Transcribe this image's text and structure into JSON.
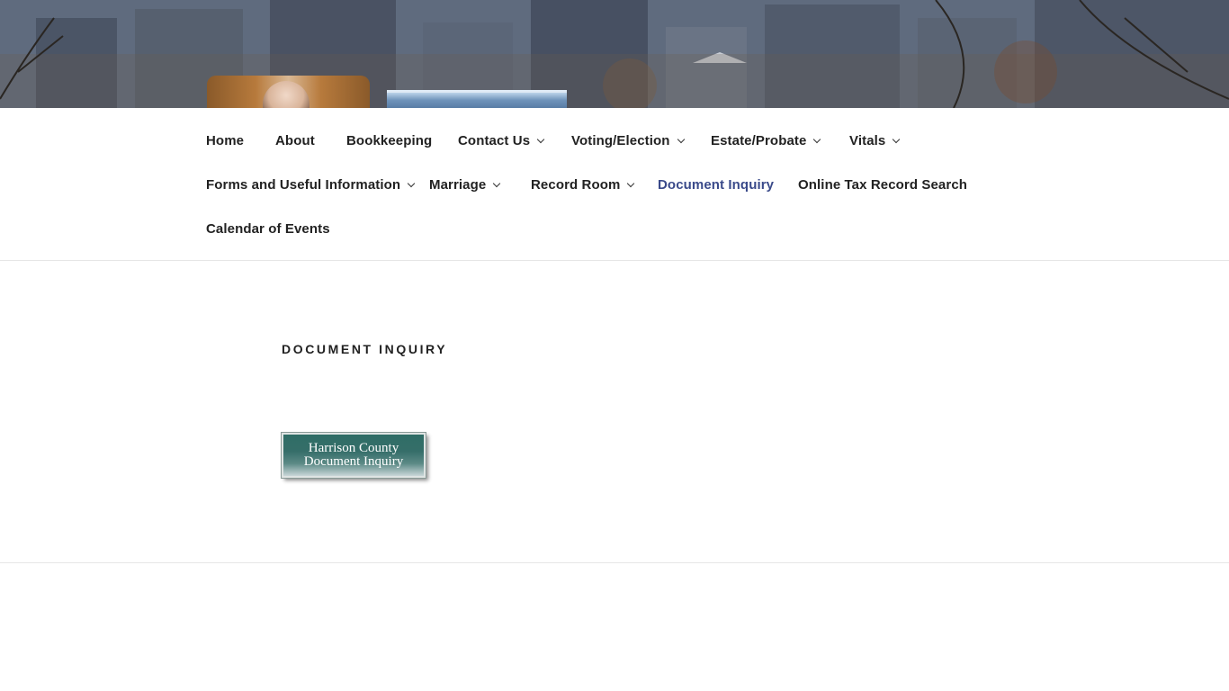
{
  "nav": {
    "row1": [
      {
        "label": "Home",
        "dropdown": false
      },
      {
        "label": "About",
        "dropdown": false
      },
      {
        "label": "Bookkeeping",
        "dropdown": false
      },
      {
        "label": "Contact Us",
        "dropdown": true
      },
      {
        "label": "Voting/Election",
        "dropdown": true
      },
      {
        "label": "Estate/Probate",
        "dropdown": true
      },
      {
        "label": "Vitals",
        "dropdown": true
      }
    ],
    "row2": [
      {
        "label": "Forms and Useful Information",
        "dropdown": true
      },
      {
        "label": "Marriage",
        "dropdown": true
      },
      {
        "label": "Record Room",
        "dropdown": true
      },
      {
        "label": "Document Inquiry",
        "dropdown": false,
        "current": true
      },
      {
        "label": "Online Tax Record Search",
        "dropdown": false
      }
    ],
    "row3": [
      {
        "label": "Calendar of Events",
        "dropdown": false
      }
    ]
  },
  "page": {
    "title": "DOCUMENT INQUIRY",
    "button_line1": "Harrison County",
    "button_line2": "Document Inquiry"
  },
  "colors": {
    "current_nav": "#3a4a8a",
    "button_top": "#2f6d66"
  }
}
